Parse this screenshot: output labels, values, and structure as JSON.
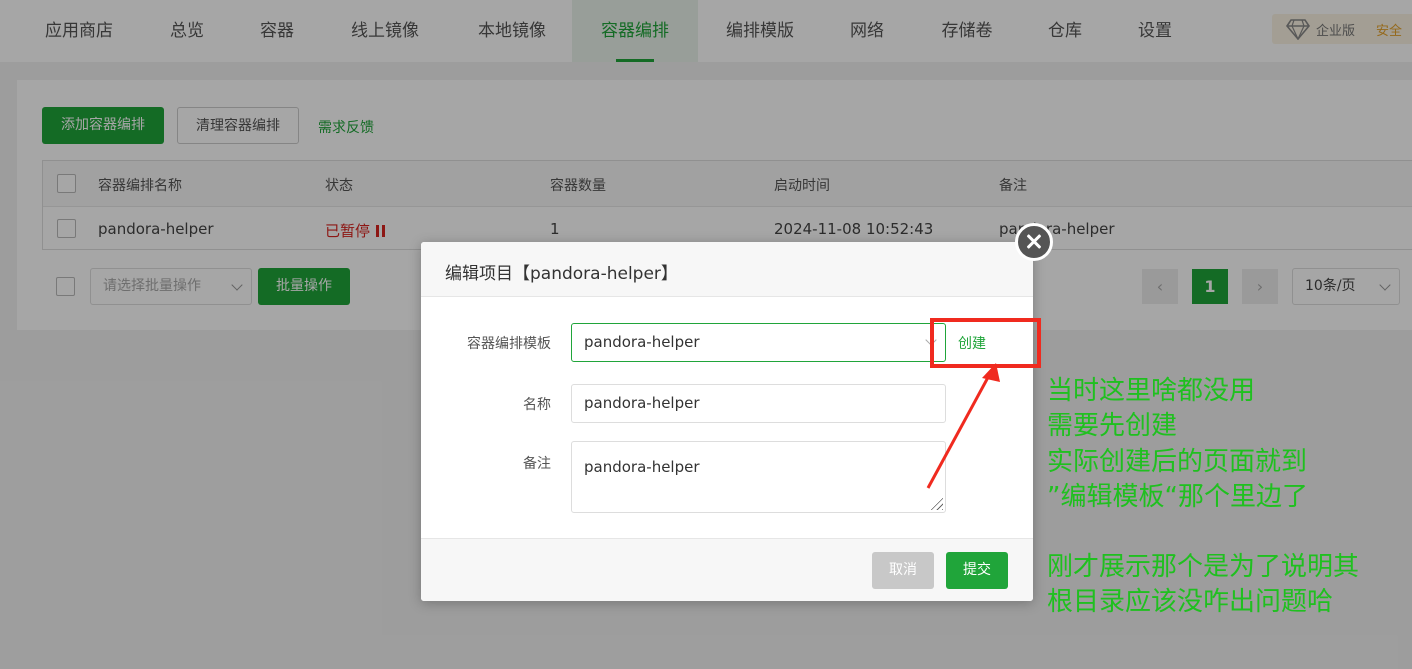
{
  "nav": {
    "tabs": [
      "应用商店",
      "总览",
      "容器",
      "线上镜像",
      "本地镜像",
      "容器编排",
      "编排模版",
      "网络",
      "存储卷",
      "仓库",
      "设置"
    ],
    "active_tab": "容器编排",
    "edition": "企业版",
    "safety_text": "安全"
  },
  "toolbar": {
    "add_label": "添加容器编排",
    "clean_label": "清理容器编排",
    "feedback_label": "需求反馈"
  },
  "table": {
    "headers": [
      "容器编排名称",
      "状态",
      "容器数量",
      "启动时间",
      "备注"
    ],
    "rows": [
      {
        "name": "pandora-helper",
        "status": "已暂停",
        "count": "1",
        "start_time": "2024-11-08 10:52:43",
        "remark": "pandora-helper"
      }
    ]
  },
  "batch": {
    "select_placeholder": "请选择批量操作",
    "button_label": "批量操作"
  },
  "pagination": {
    "current_page": "1",
    "page_size": "10条/页"
  },
  "modal": {
    "title": "编辑项目【pandora-helper】",
    "template_label": "容器编排模板",
    "template_value": "pandora-helper",
    "create_label": "创建",
    "name_label": "名称",
    "name_value": "pandora-helper",
    "remark_label": "备注",
    "remark_value": "pandora-helper",
    "cancel_label": "取消",
    "submit_label": "提交"
  },
  "annotation": {
    "lines": [
      "当时这里啥都没用",
      "需要先创建",
      "实际创建后的页面就到",
      "”编辑模板“那个里边了",
      "",
      "刚才展示那个是为了说明其",
      "根目录应该没咋出问题哈"
    ]
  },
  "colors": {
    "primary": "#20a53a",
    "danger": "#d9241f",
    "annotation": "#1fc01f",
    "highlight": "#f02a1f"
  }
}
